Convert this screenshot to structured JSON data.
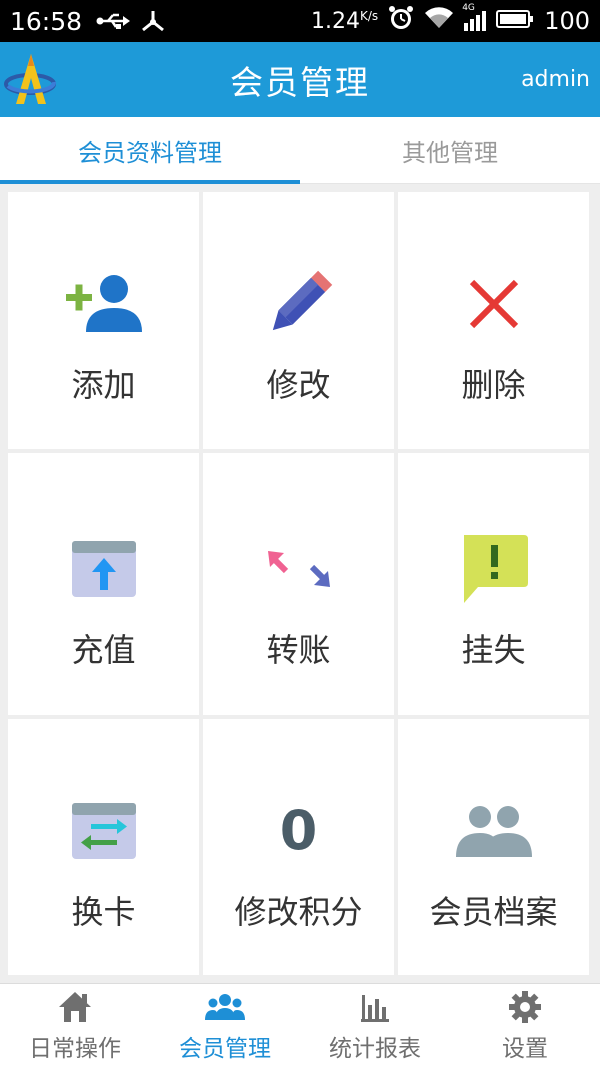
{
  "status_bar": {
    "time": "16:58",
    "speed": "1.24",
    "speed_unit": "K/s",
    "network": "4G",
    "battery": "100"
  },
  "header": {
    "title": "会员管理",
    "user": "admin"
  },
  "tabs": [
    {
      "label": "会员资料管理",
      "active": true
    },
    {
      "label": "其他管理",
      "active": false
    }
  ],
  "grid": {
    "items": [
      {
        "label": "添加",
        "icon": "add-user-icon"
      },
      {
        "label": "修改",
        "icon": "pencil-icon"
      },
      {
        "label": "删除",
        "icon": "close-icon"
      },
      {
        "label": "充值",
        "icon": "recharge-icon"
      },
      {
        "label": "转账",
        "icon": "transfer-icon"
      },
      {
        "label": "挂失",
        "icon": "report-loss-icon"
      },
      {
        "label": "换卡",
        "icon": "swap-card-icon"
      },
      {
        "label": "修改积分",
        "icon": "points-icon",
        "badge": "0"
      },
      {
        "label": "会员档案",
        "icon": "members-icon"
      }
    ]
  },
  "bottom_nav": [
    {
      "label": "日常操作",
      "icon": "home-icon",
      "active": false
    },
    {
      "label": "会员管理",
      "icon": "group-icon",
      "active": true
    },
    {
      "label": "统计报表",
      "icon": "bar-chart-icon",
      "active": false
    },
    {
      "label": "设置",
      "icon": "gear-icon",
      "active": false
    }
  ],
  "colors": {
    "primary": "#1e8fd6",
    "header": "#1e9ad8",
    "background": "#eeeeee"
  }
}
